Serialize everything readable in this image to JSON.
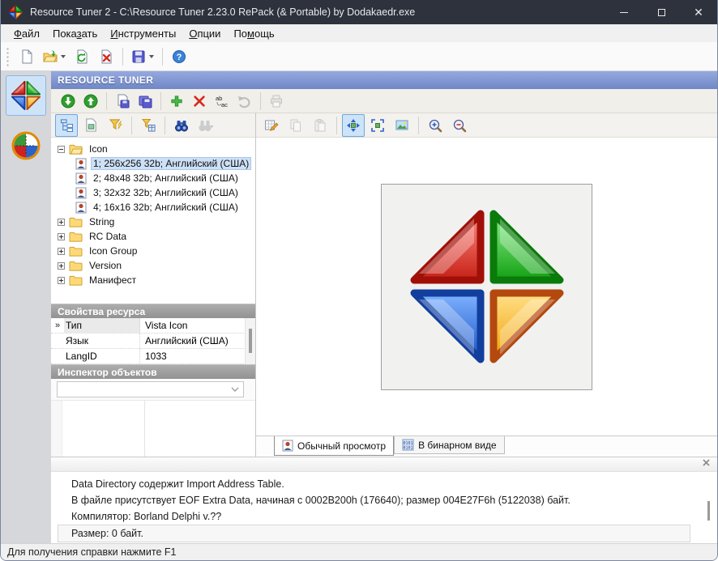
{
  "window": {
    "title": "Resource Tuner 2 - C:\\Resource Tuner 2.23.0 RePack (& Portable) by Dodakaedr.exe"
  },
  "menu": {
    "items": [
      {
        "pre": "",
        "key": "Ф",
        "post": "айл"
      },
      {
        "pre": "Пока",
        "key": "з",
        "post": "ать"
      },
      {
        "pre": "",
        "key": "И",
        "post": "нструменты"
      },
      {
        "pre": "",
        "key": "О",
        "post": "пции"
      },
      {
        "pre": "По",
        "key": "м",
        "post": "ощь"
      }
    ]
  },
  "banner": {
    "text": "RESOURCE TUNER"
  },
  "toolbars": {
    "main": [
      "new-file",
      "open-file",
      "reload-file",
      "close-file",
      "save-file",
      "help"
    ],
    "resource": [
      "go-down",
      "go-up",
      "save-resource",
      "save-all-resources",
      "add-resource",
      "delete-resource",
      "rename-resource",
      "undo",
      "print"
    ],
    "tree_panel": [
      "tree-view",
      "preview-pane",
      "quick-filter",
      "filter-settings",
      "find",
      "find-next"
    ],
    "viewer_panel": [
      "edit-resource",
      "copy",
      "paste",
      "fit-to-window",
      "actual-size",
      "image-background",
      "zoom-in",
      "zoom-out"
    ]
  },
  "tree": {
    "root_label": "Icon",
    "items": [
      "1; 256x256 32b; Английский (США)",
      "2; 48x48 32b; Английский (США)",
      "3; 32x32 32b; Английский (США)",
      "4; 16x16 32b; Английский (США)"
    ],
    "folders": [
      "String",
      "RC Data",
      "Icon Group",
      "Version",
      "Манифест"
    ]
  },
  "properties": {
    "header": "Свойства ресурса",
    "marker": "»",
    "rows": [
      {
        "name": "Тип",
        "value": "Vista Icon"
      },
      {
        "name": "Язык",
        "value": "Английский (США)"
      },
      {
        "name": "LangID",
        "value": "1033"
      }
    ]
  },
  "inspector": {
    "header": "Инспектор объектов",
    "combo_value": ""
  },
  "viewer": {
    "tabs": [
      {
        "label": "Обычный просмотр",
        "active": true
      },
      {
        "label": "В бинарном виде",
        "active": false
      }
    ]
  },
  "info_panel": {
    "lines": [
      "Data Directory содержит Import Address Table.",
      "В файле присутствует EOF Extra Data, начиная с 0002B200h (176640); размер 004E27F6h (5122038) байт.",
      "Компилятор: Borland Delphi v.??",
      "Размер: 0 байт."
    ]
  },
  "status_bar": {
    "text": "Для получения справки нажмите F1"
  },
  "colors": {
    "titlebar": "#2d323c",
    "banner_top": "#95a9de",
    "banner_bottom": "#7087c6",
    "selection": "#cde0f6",
    "logo_red": "#c62016",
    "logo_green": "#12a012",
    "logo_blue": "#1a53c8",
    "logo_yellow": "#f0a000"
  }
}
